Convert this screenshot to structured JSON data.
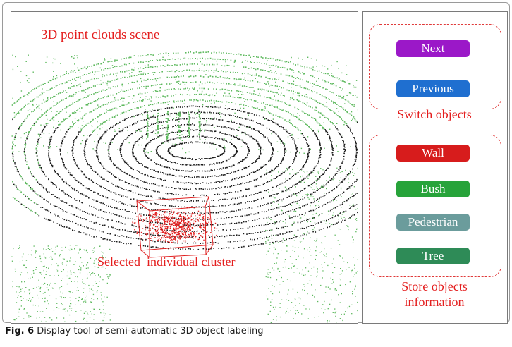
{
  "scene": {
    "title": "3D point clouds scene",
    "cluster_label": "Selected  individual cluster"
  },
  "switch_group": {
    "caption": "Switch objects",
    "buttons": [
      {
        "label": "Next",
        "color": "#9b18c8"
      },
      {
        "label": "Previous",
        "color": "#1f6fd0"
      }
    ]
  },
  "store_group": {
    "caption_line1": "Store objects",
    "caption_line2": "information",
    "buttons": [
      {
        "label": "Wall",
        "color": "#d71c1c"
      },
      {
        "label": "Bush",
        "color": "#27a33a"
      },
      {
        "label": "Pedestrian",
        "color": "#6b9c9c"
      },
      {
        "label": "Tree",
        "color": "#2e8b57"
      }
    ]
  },
  "figure_caption": {
    "number": "Fig. 6",
    "text": "Display tool of semi-automatic 3D object labeling"
  },
  "colors": {
    "accent_red": "#e41e1e",
    "point_black": "#1a1a1a",
    "point_green": "#5cb85c",
    "cluster_red": "#e02020"
  }
}
